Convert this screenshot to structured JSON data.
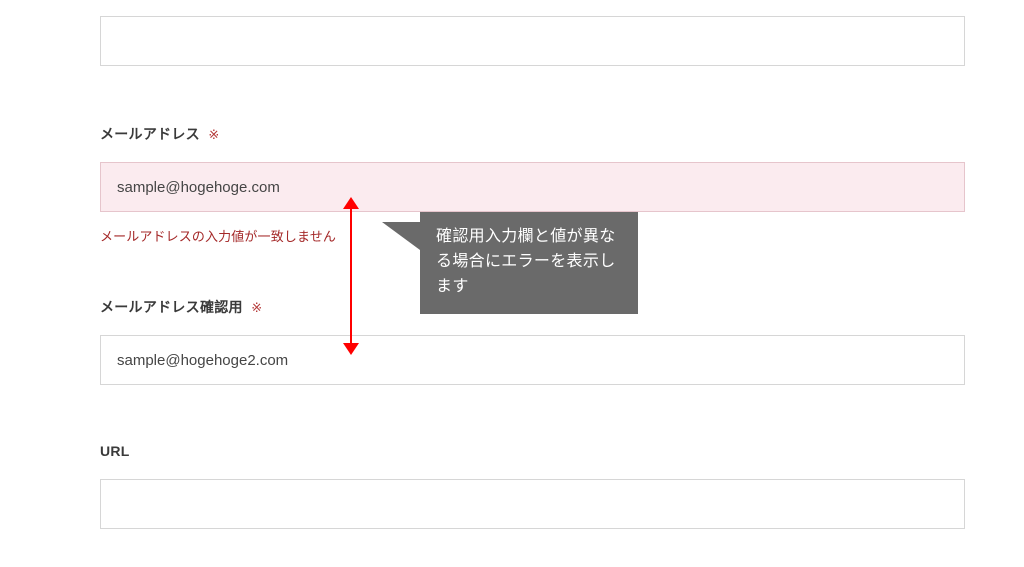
{
  "top_field": {
    "value": ""
  },
  "email": {
    "label": "メールアドレス",
    "required_mark": "※",
    "value": "sample@hogehoge.com",
    "error_message": "メールアドレスの入力値が一致しません"
  },
  "email_confirm": {
    "label": "メールアドレス確認用",
    "required_mark": "※",
    "value": "sample@hogehoge2.com"
  },
  "url_field": {
    "label": "URL",
    "value": ""
  },
  "callout": {
    "text": "確認用入力欄と値が異なる場合にエラーを表示します"
  },
  "colors": {
    "error_bg": "#fbebef",
    "error_text": "#a42828",
    "required_mark": "#b43939",
    "callout_bg": "#6a6a6a",
    "arrow": "#ff0000"
  }
}
